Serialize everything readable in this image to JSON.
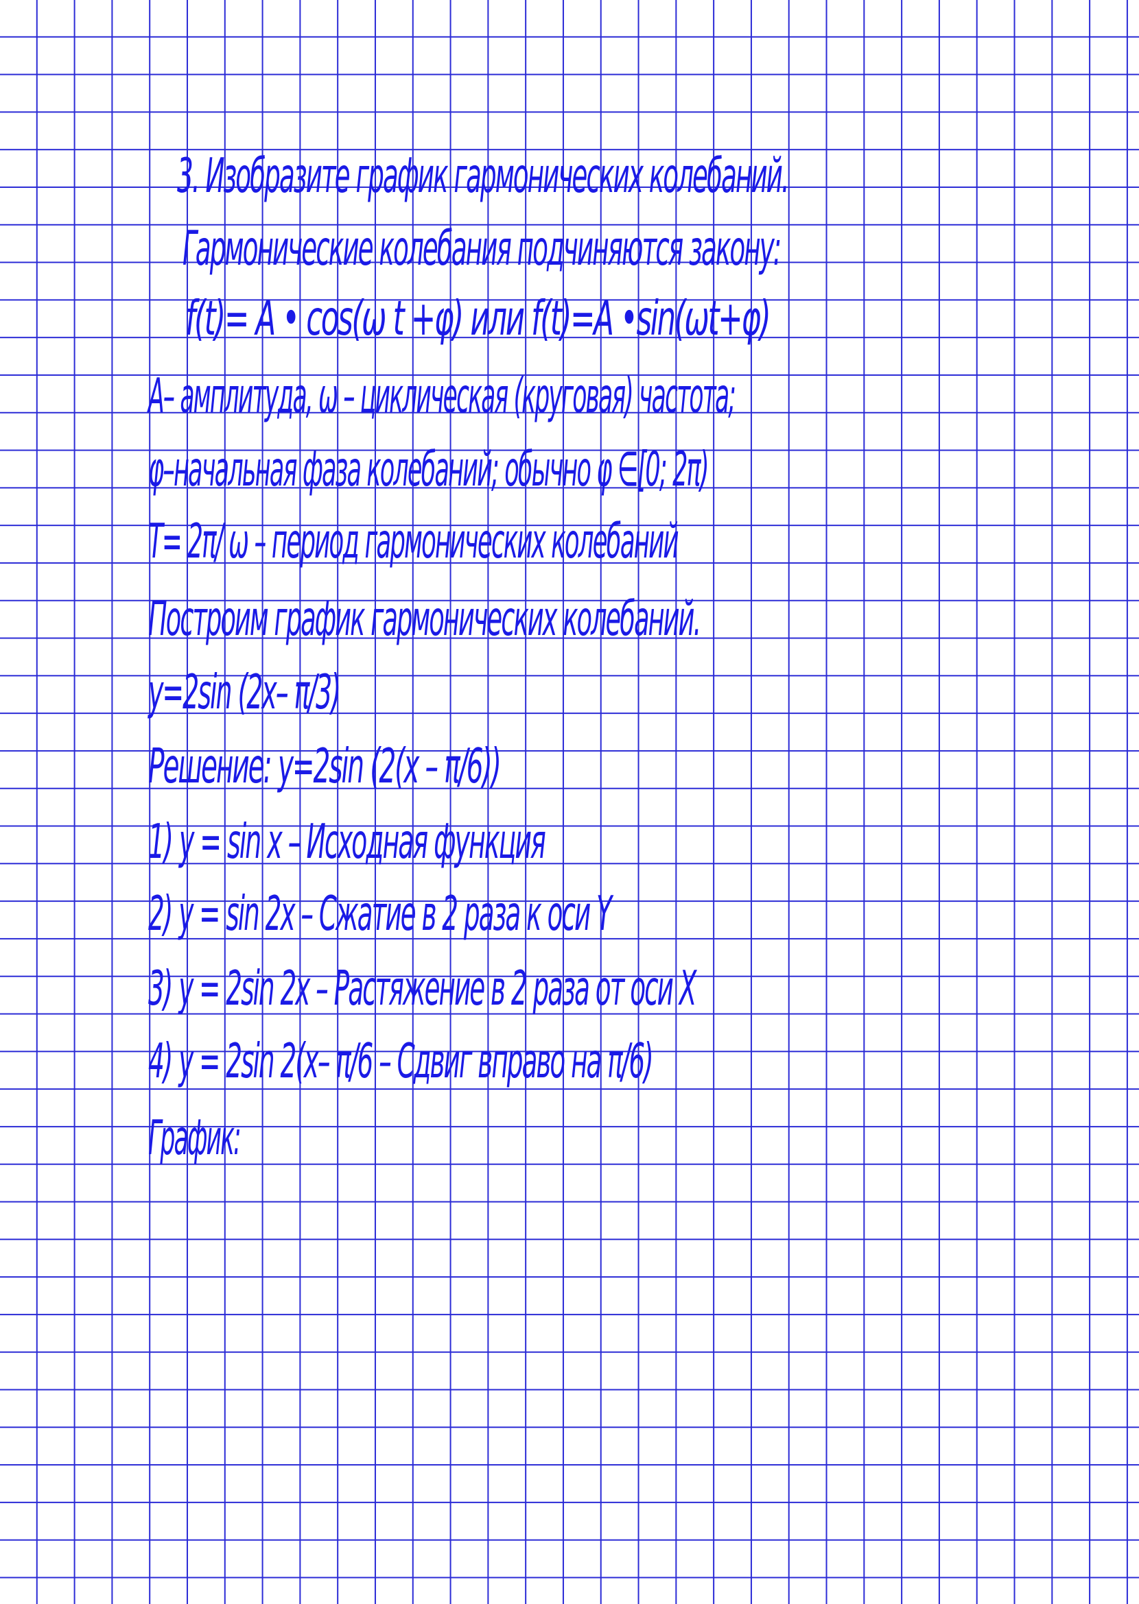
{
  "page": {
    "ink_color": "#1a1ae6",
    "grid_color": "#2b2bd6",
    "lines": [
      "3. Изобразите график гармонических колебаний.",
      "Гармонические колебания подчиняются закону:",
      "f(t)= A • cos(ω t +φ) или f(t)=A •sin(ωt+φ)",
      "A– амплитуда, ω – циклическая (круговая) частота;",
      "φ–начальная фаза колебаний; обычно φ ∈[0; 2π)",
      "T= 2π/ ω – период гармонических колебаний",
      "Построим график гармонических колебаний.",
      "y=2sin (2x– π/3)",
      "Решение: y=2sin (2(x – π/6))",
      "1) y  = sin x   – Исходная функция",
      "2) y = sin 2x  – Сжатие в 2 раза к оси Y",
      "3) y = 2sin 2x  – Растяжение в 2 раза от оси X",
      "4) y = 2sin 2(x– π/6 – Сдвиг вправо на π/6)",
      "График:"
    ]
  }
}
